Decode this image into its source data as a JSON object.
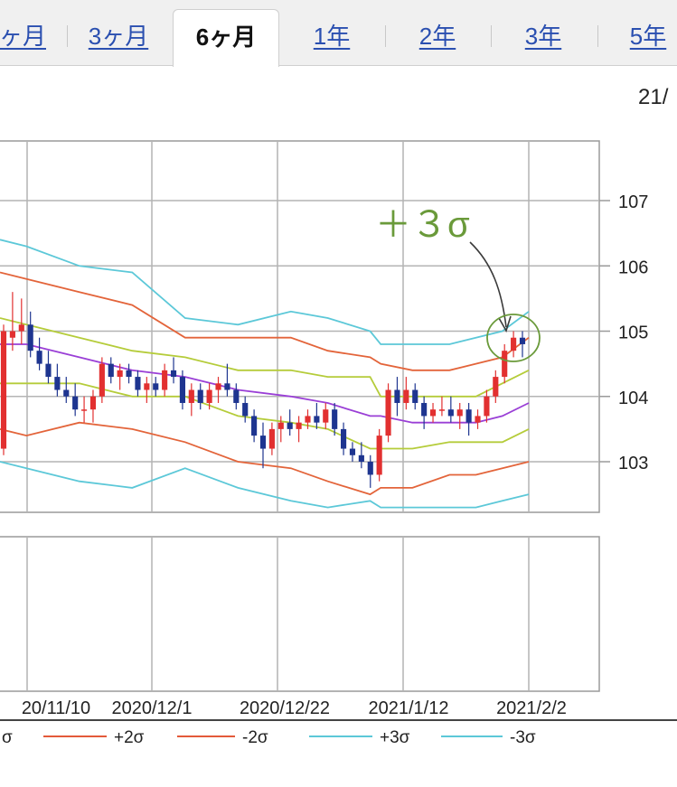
{
  "tabs": [
    {
      "label": "ヶ月",
      "active": false
    },
    {
      "label": "3ヶ月",
      "active": false
    },
    {
      "label": "6ヶ月",
      "active": true
    },
    {
      "label": "1年",
      "active": false
    },
    {
      "label": "2年",
      "active": false
    },
    {
      "label": "3年",
      "active": false
    },
    {
      "label": "5年",
      "active": false
    }
  ],
  "header_date_partial": "21/",
  "annotation": {
    "text": "＋３σ",
    "color": "#6a9a3a"
  },
  "chart_data": {
    "type": "candlestick",
    "y_ticks": [
      "107",
      "106",
      "105",
      "104",
      "103"
    ],
    "ylim": [
      102.3,
      108.0
    ],
    "x_tick_labels": [
      "20/11/10",
      "2020/12/1",
      "2020/12/22",
      "2021/1/12",
      "2021/2/2"
    ],
    "legend": [
      {
        "label": "σ",
        "color": "#e35a3a"
      },
      {
        "label": "+2σ",
        "color": "#e35a3a"
      },
      {
        "label": "-2σ",
        "color": "#e35a3a"
      },
      {
        "label": "+3σ",
        "color": "#5cc8d8"
      },
      {
        "label": "-3σ",
        "color": "#5cc8d8"
      }
    ],
    "colors": {
      "up": "#e23030",
      "down": "#1e3590",
      "ma": "#9a3fd6",
      "sigma1": "#b5cc3a",
      "sigma2": "#e3643a",
      "sigma3": "#5cc8d8"
    },
    "candles": [
      [
        103.2,
        105.1,
        103.1,
        105.0
      ],
      [
        104.9,
        105.6,
        104.7,
        105.0
      ],
      [
        105.0,
        105.5,
        104.8,
        105.1
      ],
      [
        105.1,
        105.3,
        104.6,
        104.7
      ],
      [
        104.7,
        104.9,
        104.4,
        104.5
      ],
      [
        104.5,
        104.7,
        104.2,
        104.3
      ],
      [
        104.3,
        104.5,
        104.0,
        104.1
      ],
      [
        104.1,
        104.3,
        103.9,
        104.0
      ],
      [
        104.0,
        104.2,
        103.7,
        103.8
      ],
      [
        103.8,
        104.0,
        103.6,
        103.8
      ],
      [
        103.8,
        104.1,
        103.6,
        104.0
      ],
      [
        104.0,
        104.6,
        103.9,
        104.5
      ],
      [
        104.5,
        104.6,
        104.2,
        104.3
      ],
      [
        104.3,
        104.5,
        104.1,
        104.4
      ],
      [
        104.4,
        104.5,
        104.2,
        104.3
      ],
      [
        104.3,
        104.4,
        104.0,
        104.1
      ],
      [
        104.1,
        104.3,
        103.9,
        104.2
      ],
      [
        104.2,
        104.3,
        104.0,
        104.1
      ],
      [
        104.1,
        104.5,
        104.0,
        104.4
      ],
      [
        104.4,
        104.6,
        104.2,
        104.3
      ],
      [
        104.3,
        104.4,
        103.8,
        103.9
      ],
      [
        103.9,
        104.2,
        103.7,
        104.1
      ],
      [
        104.1,
        104.2,
        103.8,
        103.9
      ],
      [
        103.9,
        104.2,
        103.8,
        104.1
      ],
      [
        104.1,
        104.3,
        103.9,
        104.2
      ],
      [
        104.2,
        104.5,
        104.0,
        104.1
      ],
      [
        104.1,
        104.2,
        103.8,
        103.9
      ],
      [
        103.9,
        104.0,
        103.6,
        103.7
      ],
      [
        103.7,
        103.8,
        103.3,
        103.4
      ],
      [
        103.4,
        103.6,
        102.9,
        103.2
      ],
      [
        103.2,
        103.6,
        103.1,
        103.5
      ],
      [
        103.5,
        103.7,
        103.3,
        103.6
      ],
      [
        103.6,
        103.8,
        103.4,
        103.5
      ],
      [
        103.5,
        103.7,
        103.3,
        103.6
      ],
      [
        103.6,
        103.8,
        103.5,
        103.7
      ],
      [
        103.7,
        103.9,
        103.5,
        103.6
      ],
      [
        103.6,
        103.9,
        103.5,
        103.8
      ],
      [
        103.8,
        103.9,
        103.4,
        103.5
      ],
      [
        103.5,
        103.6,
        103.1,
        103.2
      ],
      [
        103.2,
        103.3,
        103.0,
        103.1
      ],
      [
        103.1,
        103.3,
        102.9,
        103.0
      ],
      [
        103.0,
        103.1,
        102.6,
        102.8
      ],
      [
        102.8,
        103.5,
        102.7,
        103.4
      ],
      [
        103.4,
        104.2,
        103.3,
        104.1
      ],
      [
        104.1,
        104.3,
        103.7,
        103.9
      ],
      [
        103.9,
        104.3,
        103.8,
        104.1
      ],
      [
        104.1,
        104.2,
        103.8,
        103.9
      ],
      [
        103.9,
        104.0,
        103.5,
        103.7
      ],
      [
        103.7,
        103.9,
        103.6,
        103.8
      ],
      [
        103.8,
        104.0,
        103.7,
        103.8
      ],
      [
        103.8,
        104.0,
        103.6,
        103.7
      ],
      [
        103.7,
        103.9,
        103.5,
        103.8
      ],
      [
        103.8,
        103.9,
        103.4,
        103.6
      ],
      [
        103.6,
        103.8,
        103.5,
        103.7
      ],
      [
        103.7,
        104.1,
        103.6,
        104.0
      ],
      [
        104.0,
        104.4,
        103.9,
        104.3
      ],
      [
        104.3,
        104.8,
        104.2,
        104.7
      ],
      [
        104.7,
        105.0,
        104.6,
        104.9
      ],
      [
        104.9,
        105.0,
        104.6,
        104.8
      ]
    ],
    "ma_band": {
      "x": [
        0,
        0.05,
        0.15,
        0.25,
        0.35,
        0.45,
        0.55,
        0.62,
        0.7,
        0.72,
        0.78,
        0.85,
        0.9,
        0.95,
        1.0
      ],
      "ma": [
        104.8,
        104.8,
        104.6,
        104.4,
        104.3,
        104.1,
        104.0,
        103.9,
        103.7,
        103.7,
        103.6,
        103.6,
        103.6,
        103.7,
        103.9
      ],
      "p1": [
        105.2,
        105.1,
        104.9,
        104.7,
        104.6,
        104.4,
        104.4,
        104.3,
        104.3,
        104.0,
        104.0,
        104.0,
        104.0,
        104.2,
        104.4
      ],
      "m1": [
        104.2,
        104.2,
        104.2,
        104.0,
        104.0,
        103.7,
        103.6,
        103.5,
        103.2,
        103.2,
        103.2,
        103.3,
        103.3,
        103.3,
        103.5
      ],
      "p2": [
        105.9,
        105.8,
        105.6,
        105.4,
        104.9,
        104.9,
        104.9,
        104.7,
        104.6,
        104.5,
        104.4,
        104.4,
        104.5,
        104.6,
        104.9
      ],
      "m2": [
        103.5,
        103.4,
        103.6,
        103.5,
        103.3,
        103.0,
        102.9,
        102.7,
        102.5,
        102.6,
        102.6,
        102.8,
        102.8,
        102.9,
        103.0
      ],
      "p3": [
        106.4,
        106.3,
        106.0,
        105.9,
        105.2,
        105.1,
        105.3,
        105.2,
        105.0,
        104.8,
        104.8,
        104.8,
        104.9,
        105.0,
        105.3
      ],
      "m3": [
        103.0,
        102.9,
        102.7,
        102.6,
        102.9,
        102.6,
        102.4,
        102.3,
        102.4,
        102.3,
        102.3,
        102.3,
        102.3,
        102.4,
        102.5
      ]
    }
  }
}
